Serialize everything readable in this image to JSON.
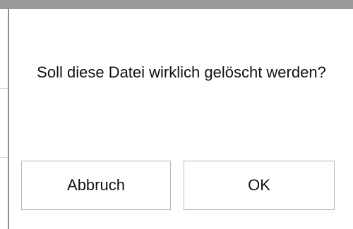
{
  "dialog": {
    "message": "Soll diese Datei wirklich gelöscht werden?",
    "cancel_label": "Abbruch",
    "ok_label": "OK"
  },
  "colors": {
    "top_bar": "#9a9a9a",
    "divider": "#8f8f8f",
    "button_border": "#b8b8b8",
    "text": "#111111"
  }
}
